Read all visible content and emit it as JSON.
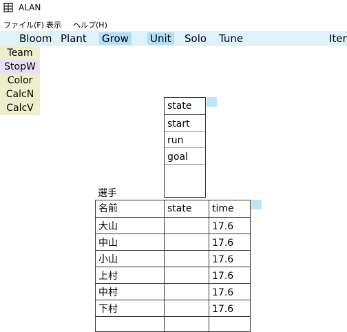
{
  "window": {
    "title": "ALAN",
    "icon": "grid-icon"
  },
  "menu": [
    "ファイル(F)",
    "表示",
    "ヘルプ(H)"
  ],
  "toolbar": {
    "items": [
      "Bloom",
      "Plant",
      "Grow",
      "Unit",
      "Solo",
      "Tune",
      "Item"
    ],
    "active": [
      "Grow",
      "Unit"
    ]
  },
  "side": [
    "Team",
    "StopW",
    "Color",
    "CalcN",
    "CalcV"
  ],
  "state_box": {
    "header": "state",
    "items": [
      "start",
      "run",
      "goal"
    ]
  },
  "table": {
    "title": "選手",
    "headers": [
      "名前",
      "state",
      "time"
    ],
    "rows": [
      {
        "name": "大山",
        "state": "",
        "time": "17.6"
      },
      {
        "name": "中山",
        "state": "",
        "time": "17.6"
      },
      {
        "name": "小山",
        "state": "",
        "time": "17.6"
      },
      {
        "name": "上村",
        "state": "",
        "time": "17.6"
      },
      {
        "name": "中村",
        "state": "",
        "time": "17.6"
      },
      {
        "name": "下村",
        "state": "",
        "time": "17.6"
      }
    ]
  },
  "colors": {
    "toolbar_bg": "#ddf3fb",
    "active_bg": "#b4def5",
    "side_yellow": "#eeeecc",
    "side_lavender": "#e8e0f8"
  }
}
